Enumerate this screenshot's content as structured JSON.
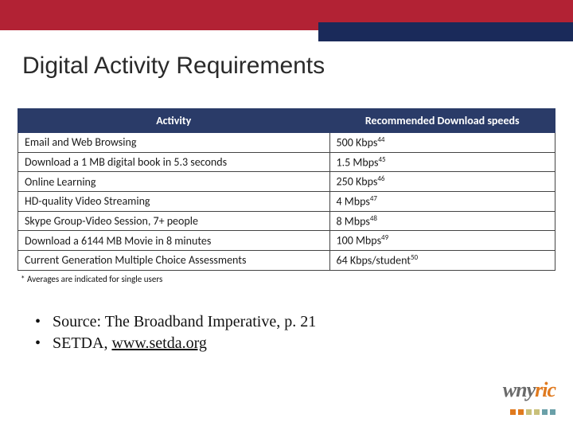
{
  "title": "Digital Activity Requirements",
  "table": {
    "headers": [
      "Activity",
      "Recommended Download speeds"
    ],
    "rows": [
      {
        "activity": "Email and Web Browsing",
        "speed": "500 Kbps",
        "ref": "44"
      },
      {
        "activity": "Download a 1 MB digital book in 5.3 seconds",
        "speed": "1.5 Mbps",
        "ref": "45"
      },
      {
        "activity": "Online Learning",
        "speed": "250 Kbps",
        "ref": "46"
      },
      {
        "activity": "HD-quality Video Streaming",
        "speed": "4 Mbps",
        "ref": "47"
      },
      {
        "activity": "Skype Group-Video Session, 7+ people",
        "speed": "8 Mbps",
        "ref": "48"
      },
      {
        "activity": "Download a 6144 MB Movie in 8 minutes",
        "speed": "100 Mbps",
        "ref": "49"
      },
      {
        "activity": "Current Generation Multiple Choice Assessments",
        "speed": "64 Kbps/student",
        "ref": "50"
      }
    ],
    "footnote": "* Averages are indicated for single users"
  },
  "bullets": {
    "source_label": "Source: The Broadband Imperative, p. 21",
    "org_label": "SETDA, ",
    "org_link": "www.setda.org"
  },
  "logo": {
    "text_gray": "wny",
    "text_orange": "ric",
    "dot_colors": [
      "#e07a1f",
      "#e07a1f",
      "#c9c07a",
      "#c9c07a",
      "#6aa0a8",
      "#6aa0a8"
    ]
  }
}
